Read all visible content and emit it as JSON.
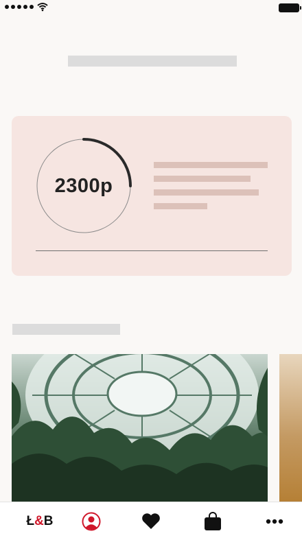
{
  "loyalty": {
    "points": "2300р",
    "progress_fraction": 0.25
  },
  "tab_bar": {
    "logo": {
      "left": "Ł",
      "amp": "&",
      "right": "B"
    },
    "items": [
      {
        "icon": "profile-icon"
      },
      {
        "icon": "heart-icon"
      },
      {
        "icon": "shopping-bag-icon"
      },
      {
        "icon": "more-dots-icon"
      }
    ]
  },
  "colors": {
    "background": "#faf8f6",
    "card": "#f6e5e1",
    "accent": "#d0172a",
    "placeholder": "#dcdcdc"
  }
}
